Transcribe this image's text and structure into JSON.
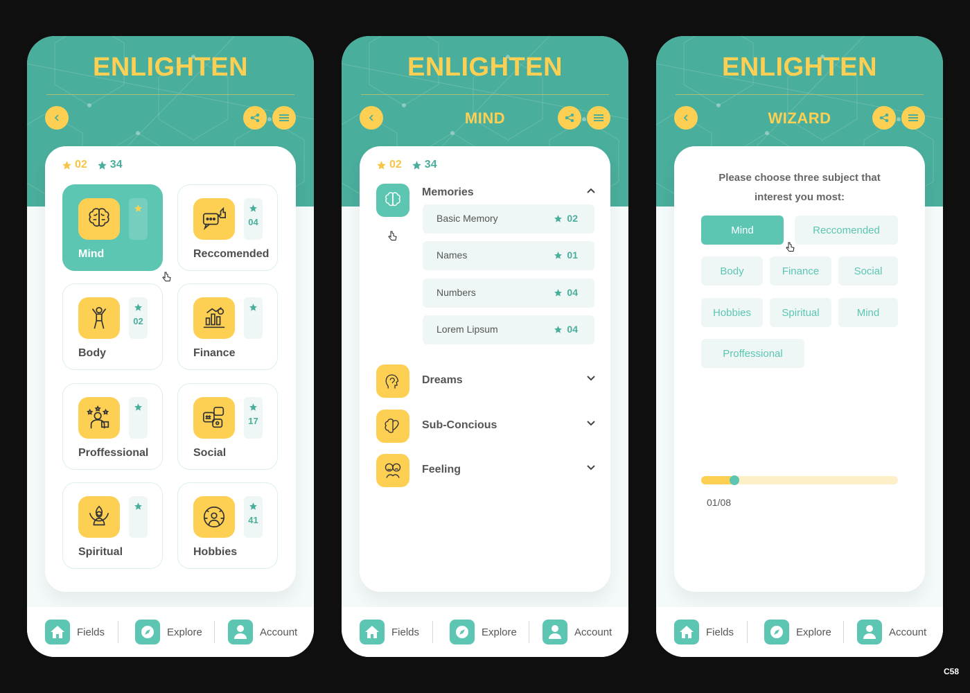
{
  "brand": "ENLIGHTEN",
  "colors": {
    "teal": "#4aae9c",
    "teal_light": "#5cc6b3",
    "yellow": "#fdd054",
    "background": "#0f0f0f"
  },
  "header_icons": [
    "chevron-left-icon",
    "share-icon",
    "menu-icon"
  ],
  "stats": {
    "yellow_stars": "02",
    "green_stars": "34"
  },
  "screen1": {
    "tiles": [
      {
        "label": "Mind",
        "count": "",
        "icon": "brain-icon",
        "active": true
      },
      {
        "label": "Reccomended",
        "count": "04",
        "icon": "thumbs-up-chat-icon",
        "active": false
      },
      {
        "label": "Body",
        "count": "02",
        "icon": "body-icon",
        "active": false
      },
      {
        "label": "Finance",
        "count": "",
        "icon": "finance-chart-icon",
        "active": false
      },
      {
        "label": "Proffessional",
        "count": "",
        "icon": "professional-icon",
        "active": false
      },
      {
        "label": "Social",
        "count": "17",
        "icon": "social-chat-icon",
        "active": false
      },
      {
        "label": "Spiritual",
        "count": "",
        "icon": "meditation-icon",
        "active": false
      },
      {
        "label": "Hobbies",
        "count": "41",
        "icon": "hobbies-icon",
        "active": false
      }
    ]
  },
  "screen2": {
    "title": "MIND",
    "sections": [
      {
        "label": "Memories",
        "expanded": true,
        "items": [
          {
            "label": "Basic Memory",
            "count": "02"
          },
          {
            "label": "Names",
            "count": "01"
          },
          {
            "label": "Numbers",
            "count": "04"
          },
          {
            "label": "Lorem Lipsum",
            "count": "04"
          }
        ]
      },
      {
        "label": "Dreams",
        "expanded": false
      },
      {
        "label": "Sub-Concious",
        "expanded": false
      },
      {
        "label": "Feeling",
        "expanded": false
      }
    ]
  },
  "screen3": {
    "title": "WIZARD",
    "question": "Please choose three subject that interest you most:",
    "chips": [
      "Mind",
      "Reccomended",
      "Body",
      "Finance",
      "Social",
      "Hobbies",
      "Spiritual",
      "Mind",
      "Proffessional"
    ],
    "selected": "Mind",
    "progress_label": "01/08",
    "progress_fraction": 0.17
  },
  "nav": {
    "fields": "Fields",
    "explore": "Explore",
    "account": "Account"
  },
  "corner_tag": "C58"
}
